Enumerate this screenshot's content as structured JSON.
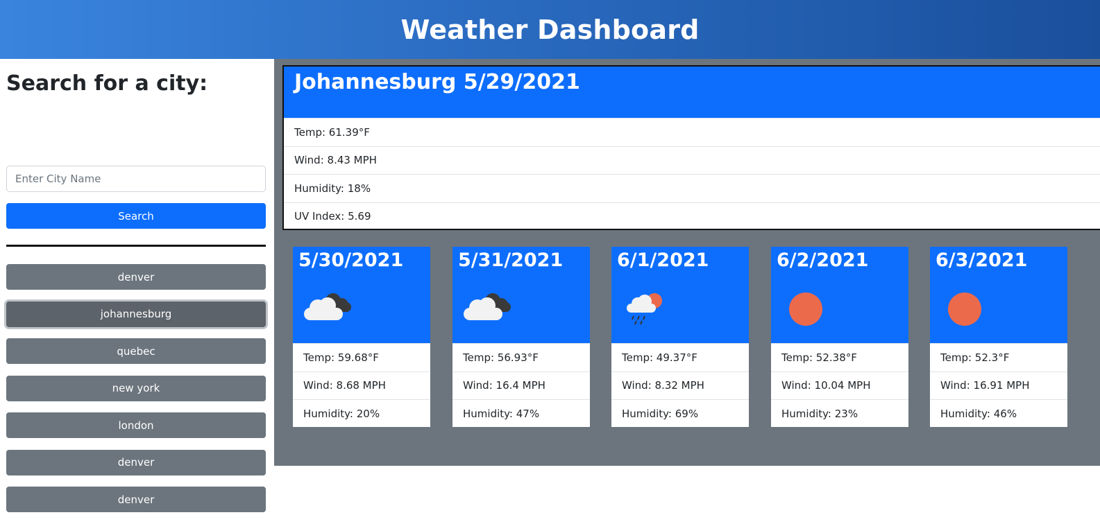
{
  "header": {
    "title": "Weather Dashboard"
  },
  "sidebar": {
    "heading": "Search for a city:",
    "search_placeholder": "Enter City Name",
    "search_value": "",
    "search_button": "Search",
    "history": [
      {
        "label": "denver"
      },
      {
        "label": "johannesburg",
        "active": true
      },
      {
        "label": "quebec"
      },
      {
        "label": "new york"
      },
      {
        "label": "london"
      },
      {
        "label": "denver"
      },
      {
        "label": "denver"
      }
    ]
  },
  "current": {
    "title": "Johannesburg 5/29/2021",
    "temp": "Temp: 61.39°F",
    "wind": "Wind: 8.43 MPH",
    "humidity": "Humidity: 18%",
    "uv": "UV Index: 5.69"
  },
  "forecast": [
    {
      "date": "5/30/2021",
      "icon": "broken-clouds-icon",
      "temp": "Temp: 59.68°F",
      "wind": "Wind: 8.68 MPH",
      "humidity": "Humidity: 20%"
    },
    {
      "date": "5/31/2021",
      "icon": "broken-clouds-icon",
      "temp": "Temp: 56.93°F",
      "wind": "Wind: 16.4 MPH",
      "humidity": "Humidity: 47%"
    },
    {
      "date": "6/1/2021",
      "icon": "rain-sun-icon",
      "temp": "Temp: 49.37°F",
      "wind": "Wind: 8.32 MPH",
      "humidity": "Humidity: 69%"
    },
    {
      "date": "6/2/2021",
      "icon": "clear-sun-icon",
      "temp": "Temp: 52.38°F",
      "wind": "Wind: 10.04 MPH",
      "humidity": "Humidity: 23%"
    },
    {
      "date": "6/3/2021",
      "icon": "clear-sun-icon",
      "temp": "Temp: 52.3°F",
      "wind": "Wind: 16.91 MPH",
      "humidity": "Humidity: 46%"
    }
  ],
  "colors": {
    "primary": "#0d6efd",
    "secondary": "#6c757d",
    "header_gradient_start": "#3a84de",
    "header_gradient_end": "#1a4f9c",
    "sun": "#ec6a4c"
  }
}
